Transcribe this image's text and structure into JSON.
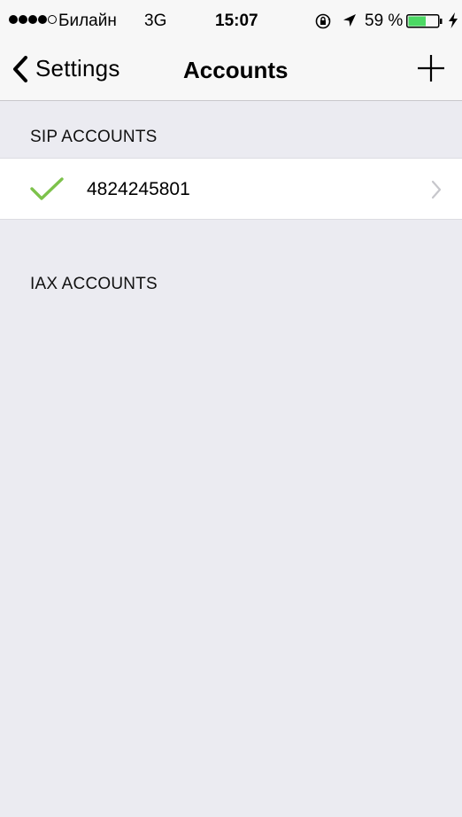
{
  "status_bar": {
    "carrier": "Билайн",
    "network": "3G",
    "time": "15:07",
    "battery_percent": "59 %",
    "signal_bars_filled": 4,
    "signal_bars_total": 5,
    "battery_level": 0.59,
    "battery_color": "#4cd964",
    "icons": [
      "signal-dots-icon",
      "orientation-lock-icon",
      "location-arrow-icon",
      "battery-icon",
      "charging-bolt-icon"
    ]
  },
  "nav_bar": {
    "back_label": "Settings",
    "title": "Accounts",
    "add_icon": "plus-icon"
  },
  "sections": [
    {
      "header": "SIP ACCOUNTS",
      "accounts": [
        {
          "number": "4824245801",
          "status_icon": "checkmark-icon",
          "accessory_icon": "chevron-right-icon"
        }
      ]
    },
    {
      "header": "IAX ACCOUNTS",
      "accounts": []
    }
  ],
  "colors": {
    "checkmark": "#7dc24b",
    "background": "#ebebf1",
    "bar": "#f7f7f7",
    "disclosure": "#c7c7cc"
  }
}
